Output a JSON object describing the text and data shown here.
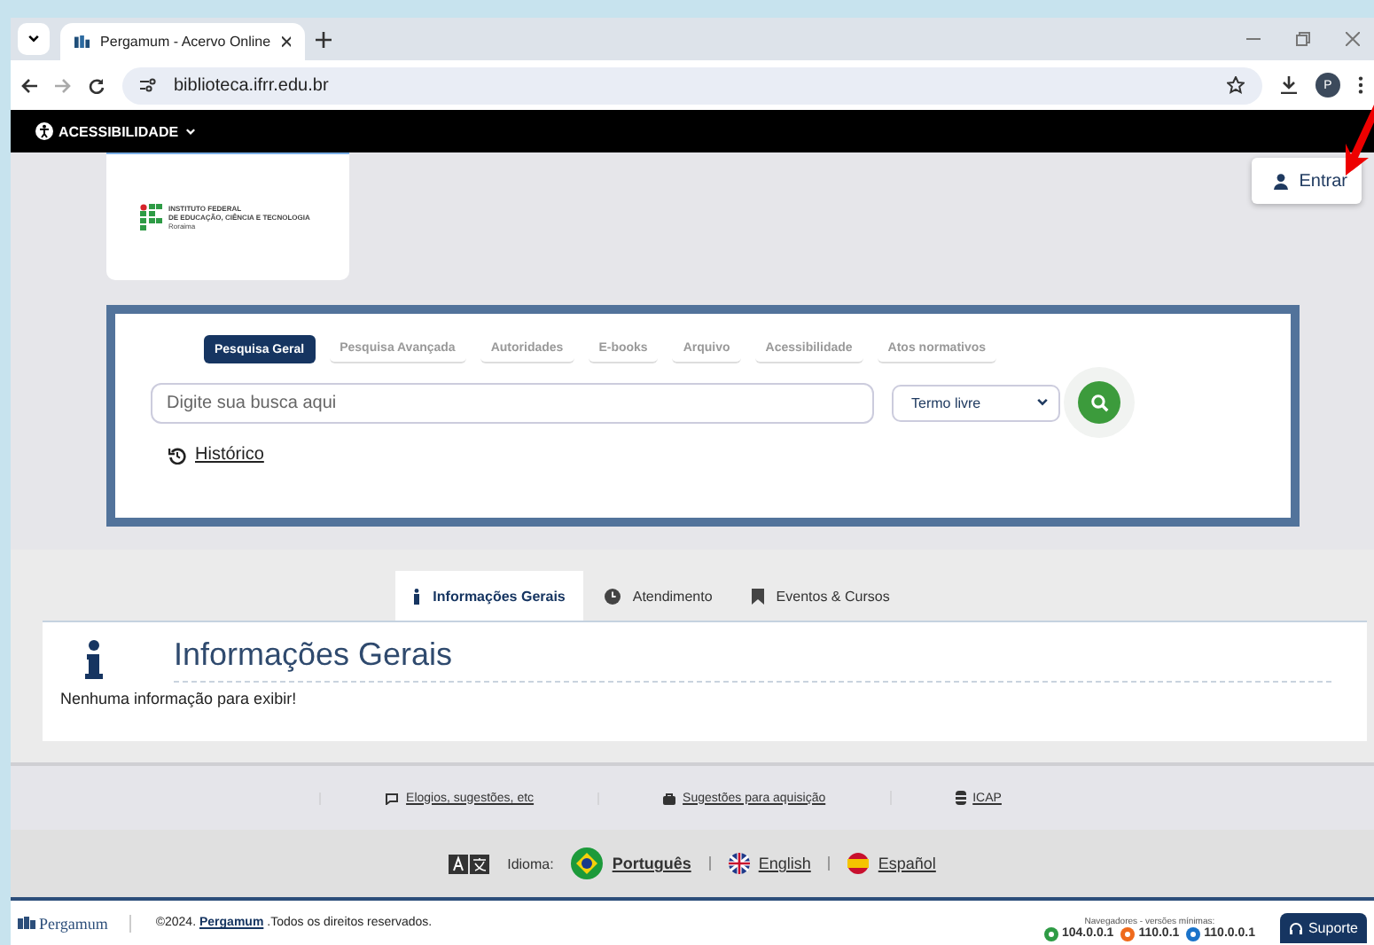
{
  "browser": {
    "tab_title": "Pergamum - Acervo Online",
    "url": "biblioteca.ifrr.edu.br",
    "profile_initial": "P"
  },
  "accessibility_menu": "ACESSIBILIDADE",
  "login_button": "Entrar",
  "logo": {
    "lines": [
      "INSTITUTO FEDERAL",
      "DE EDUCAÇÃO, CIÊNCIA E TECNOLOGIA",
      "Roraima"
    ]
  },
  "search": {
    "tabs": [
      {
        "label": "Pesquisa Geral",
        "selected": true
      },
      {
        "label": "Pesquisa Avançada",
        "selected": false
      },
      {
        "label": "Autoridades",
        "selected": false
      },
      {
        "label": "E-books",
        "selected": false
      },
      {
        "label": "Arquivo",
        "selected": false
      },
      {
        "label": "Acessibilidade",
        "selected": false
      },
      {
        "label": "Atos normativos",
        "selected": false
      }
    ],
    "placeholder": "Digite sua busca aqui",
    "select_value": "Termo livre",
    "history_link": "Histórico"
  },
  "info_tabs": [
    {
      "label": "Informações Gerais",
      "selected": true,
      "kind": "info"
    },
    {
      "label": "Atendimento",
      "selected": false,
      "kind": "clock"
    },
    {
      "label": "Eventos & Cursos",
      "selected": false,
      "kind": "bookmark"
    }
  ],
  "info_panel": {
    "title": "Informações Gerais",
    "message": "Nenhuma informação para exibir!"
  },
  "footer_links": [
    {
      "label": "Elogios, sugestões, etc",
      "kind": "comment"
    },
    {
      "label": "Sugestões para aquisição",
      "kind": "bag"
    },
    {
      "label": "ICAP",
      "kind": "database"
    }
  ],
  "language": {
    "label": "Idioma:",
    "options": [
      {
        "label": "Português",
        "selected": true,
        "kind": "br"
      },
      {
        "label": "English",
        "selected": false,
        "kind": "uk"
      },
      {
        "label": "Español",
        "selected": false,
        "kind": "es"
      }
    ]
  },
  "bottom": {
    "brand": "Pergamum",
    "copyright": "©2024.",
    "copyright_link": "Pergamum",
    "copyright_rest": ".Todos os direitos reservados.",
    "browsers_label": "Navegadores - versões mínimas:",
    "browsers": [
      {
        "version": "104.0.0.1",
        "kind": "chrome"
      },
      {
        "version": "110.0.1",
        "kind": "firefox"
      },
      {
        "version": "110.0.0.1",
        "kind": "edge"
      }
    ],
    "support_button": "Suporte"
  }
}
